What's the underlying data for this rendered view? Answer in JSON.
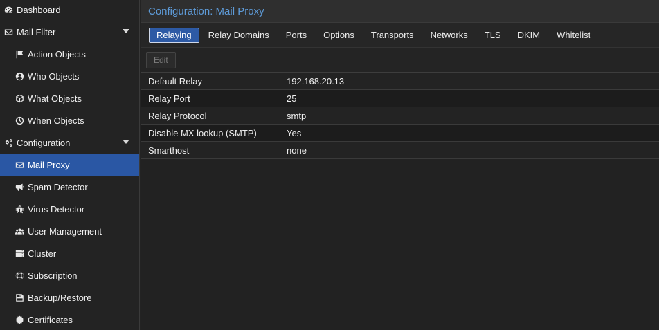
{
  "sidebar": {
    "items": [
      {
        "label": "Dashboard",
        "icon": "dashboard-icon"
      },
      {
        "label": "Mail Filter",
        "icon": "envelope-icon",
        "expanded": true
      },
      {
        "label": "Action Objects",
        "icon": "flag-icon"
      },
      {
        "label": "Who Objects",
        "icon": "user-circle-icon"
      },
      {
        "label": "What Objects",
        "icon": "cube-icon"
      },
      {
        "label": "When Objects",
        "icon": "clock-icon"
      },
      {
        "label": "Configuration",
        "icon": "cogs-icon",
        "expanded": true
      },
      {
        "label": "Mail Proxy",
        "icon": "envelope-icon",
        "selected": true
      },
      {
        "label": "Spam Detector",
        "icon": "bullhorn-icon"
      },
      {
        "label": "Virus Detector",
        "icon": "bug-icon"
      },
      {
        "label": "User Management",
        "icon": "users-icon"
      },
      {
        "label": "Cluster",
        "icon": "server-icon"
      },
      {
        "label": "Subscription",
        "icon": "life-ring-icon"
      },
      {
        "label": "Backup/Restore",
        "icon": "floppy-disk-icon"
      },
      {
        "label": "Certificates",
        "icon": "certificate-icon"
      }
    ]
  },
  "panel": {
    "title": "Configuration: Mail Proxy"
  },
  "tabs": [
    {
      "label": "Relaying",
      "active": true
    },
    {
      "label": "Relay Domains"
    },
    {
      "label": "Ports"
    },
    {
      "label": "Options"
    },
    {
      "label": "Transports"
    },
    {
      "label": "Networks"
    },
    {
      "label": "TLS"
    },
    {
      "label": "DKIM"
    },
    {
      "label": "Whitelist"
    }
  ],
  "toolbar": {
    "edit_label": "Edit"
  },
  "grid": {
    "rows": [
      {
        "name": "Default Relay",
        "value": "192.168.20.13"
      },
      {
        "name": "Relay Port",
        "value": "25"
      },
      {
        "name": "Relay Protocol",
        "value": "smtp"
      },
      {
        "name": "Disable MX lookup (SMTP)",
        "value": "Yes"
      },
      {
        "name": "Smarthost",
        "value": "none"
      }
    ]
  },
  "colors": {
    "accent": "#2a57a4",
    "title": "#5e9bd8",
    "background": "#232323"
  }
}
